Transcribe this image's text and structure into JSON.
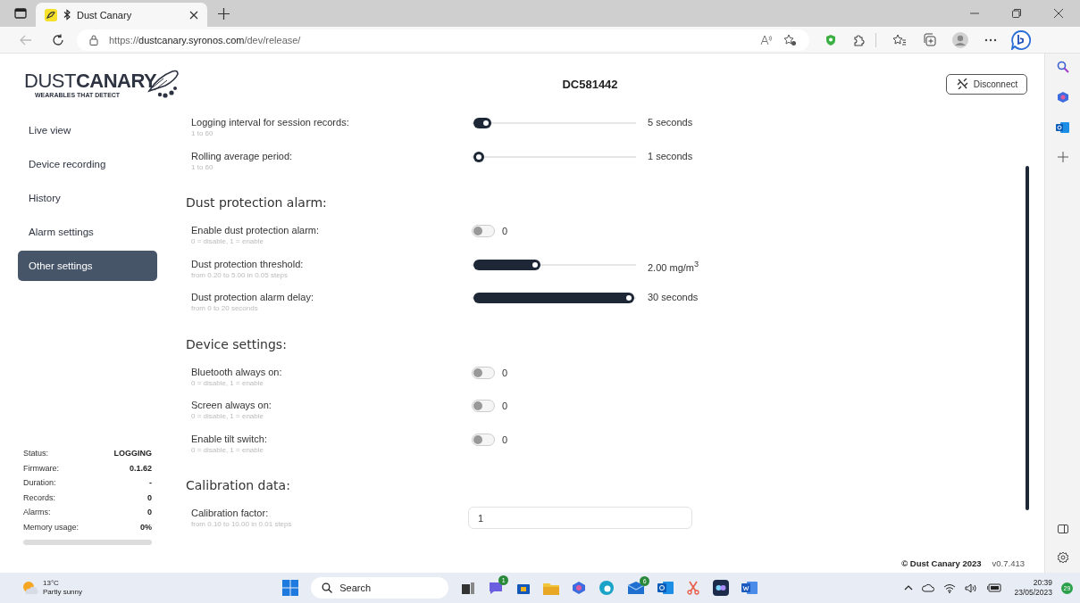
{
  "browser": {
    "tab_title": "Dust Canary",
    "url_scheme": "https://",
    "url_host": "dustcanary.syronos.com",
    "url_path": "/dev/release/"
  },
  "header": {
    "logo_light": "DUST",
    "logo_bold": "CANARY",
    "tagline": "WEARABLES THAT DETECT",
    "device": "DC581442",
    "disconnect": "Disconnect"
  },
  "nav": [
    {
      "label": "Live view",
      "selected": false
    },
    {
      "label": "Device recording",
      "selected": false
    },
    {
      "label": "History",
      "selected": false
    },
    {
      "label": "Alarm settings",
      "selected": false
    },
    {
      "label": "Other settings",
      "selected": true
    }
  ],
  "status": [
    {
      "label": "Status:",
      "value": "LOGGING"
    },
    {
      "label": "Firmware:",
      "value": "0.1.62"
    },
    {
      "label": "Duration:",
      "value": "-"
    },
    {
      "label": "Records:",
      "value": "0"
    },
    {
      "label": "Alarms:",
      "value": "0"
    },
    {
      "label": "Memory usage:",
      "value": "0%"
    }
  ],
  "sections": [
    {
      "rows": [
        {
          "kind": "slider",
          "label": "Logging interval for session records:",
          "hint": "1 to 60",
          "level": 0.05,
          "value": "5 seconds"
        },
        {
          "kind": "slider",
          "label": "Rolling average period:",
          "hint": "1 to 60",
          "level": 0,
          "value": "1 seconds"
        }
      ]
    },
    {
      "heading": "Dust protection alarm:",
      "rows": [
        {
          "kind": "toggle",
          "label": "Enable dust protection alarm:",
          "hint": "0 = disable, 1 = enable",
          "on": false,
          "value": "0"
        },
        {
          "kind": "slider",
          "label": "Dust protection threshold:",
          "hint": "from 0.20 to 5.00 in 0.05 steps",
          "level": 0.375,
          "value": "2.00 mg/m$^{3}$"
        },
        {
          "kind": "slider",
          "label": "Dust protection alarm delay:",
          "hint": "from 0 to 20 seconds",
          "level": 1,
          "value": "30 seconds"
        }
      ]
    },
    {
      "heading": "Device settings:",
      "rows": [
        {
          "kind": "toggle",
          "label": "Bluetooth always on:",
          "hint": "0 = disable, 1 = enable",
          "on": false,
          "value": "0"
        },
        {
          "kind": "toggle",
          "label": "Screen always on:",
          "hint": "0 = disable, 1 = enable",
          "on": false,
          "value": "0"
        },
        {
          "kind": "toggle",
          "label": "Enable tilt switch:",
          "hint": "0 = disable, 1 = enable",
          "on": false,
          "value": "0"
        }
      ]
    },
    {
      "heading": "Calibration data:",
      "rows": [
        {
          "kind": "number",
          "label": "Calibration factor:",
          "hint": "from 0.10 to 10.00 in 0.01 steps",
          "value": "1"
        }
      ]
    }
  ],
  "footer": {
    "copyright": "© Dust Canary 2023",
    "version": "v0.7.413"
  },
  "taskbar": {
    "temperature": "13°C",
    "weather": "Partly sunny",
    "search": "Search",
    "chat_badge": "1",
    "mail_badge": "6",
    "time": "20:39",
    "date": "23/05/2023",
    "notifications": "29"
  }
}
